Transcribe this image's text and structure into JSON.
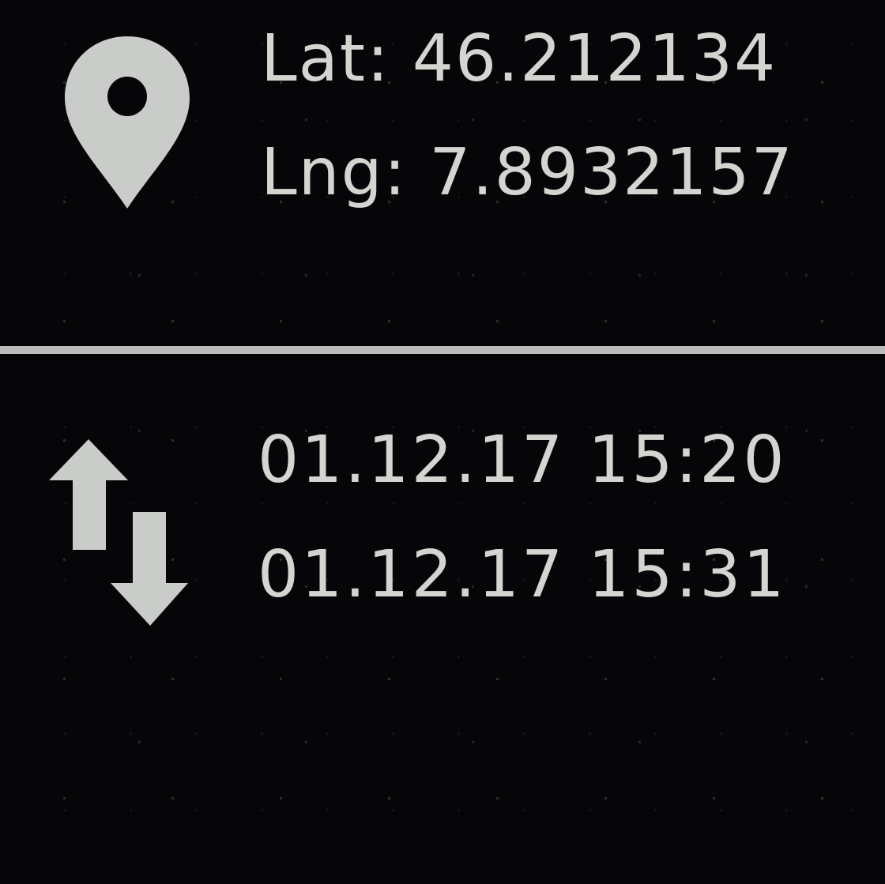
{
  "location": {
    "icon": "map-pin-icon",
    "latitude_text": "Lat: 46.212134",
    "longitude_text": "Lng: 7.8932157"
  },
  "sync": {
    "icon": "upload-download-arrows-icon",
    "upload_time": "01.12.17 15:20",
    "download_time": "01.12.17 15:31"
  },
  "colors": {
    "background": "#060608",
    "foreground": "#d3d5d1",
    "divider": "#b9bcb8"
  }
}
